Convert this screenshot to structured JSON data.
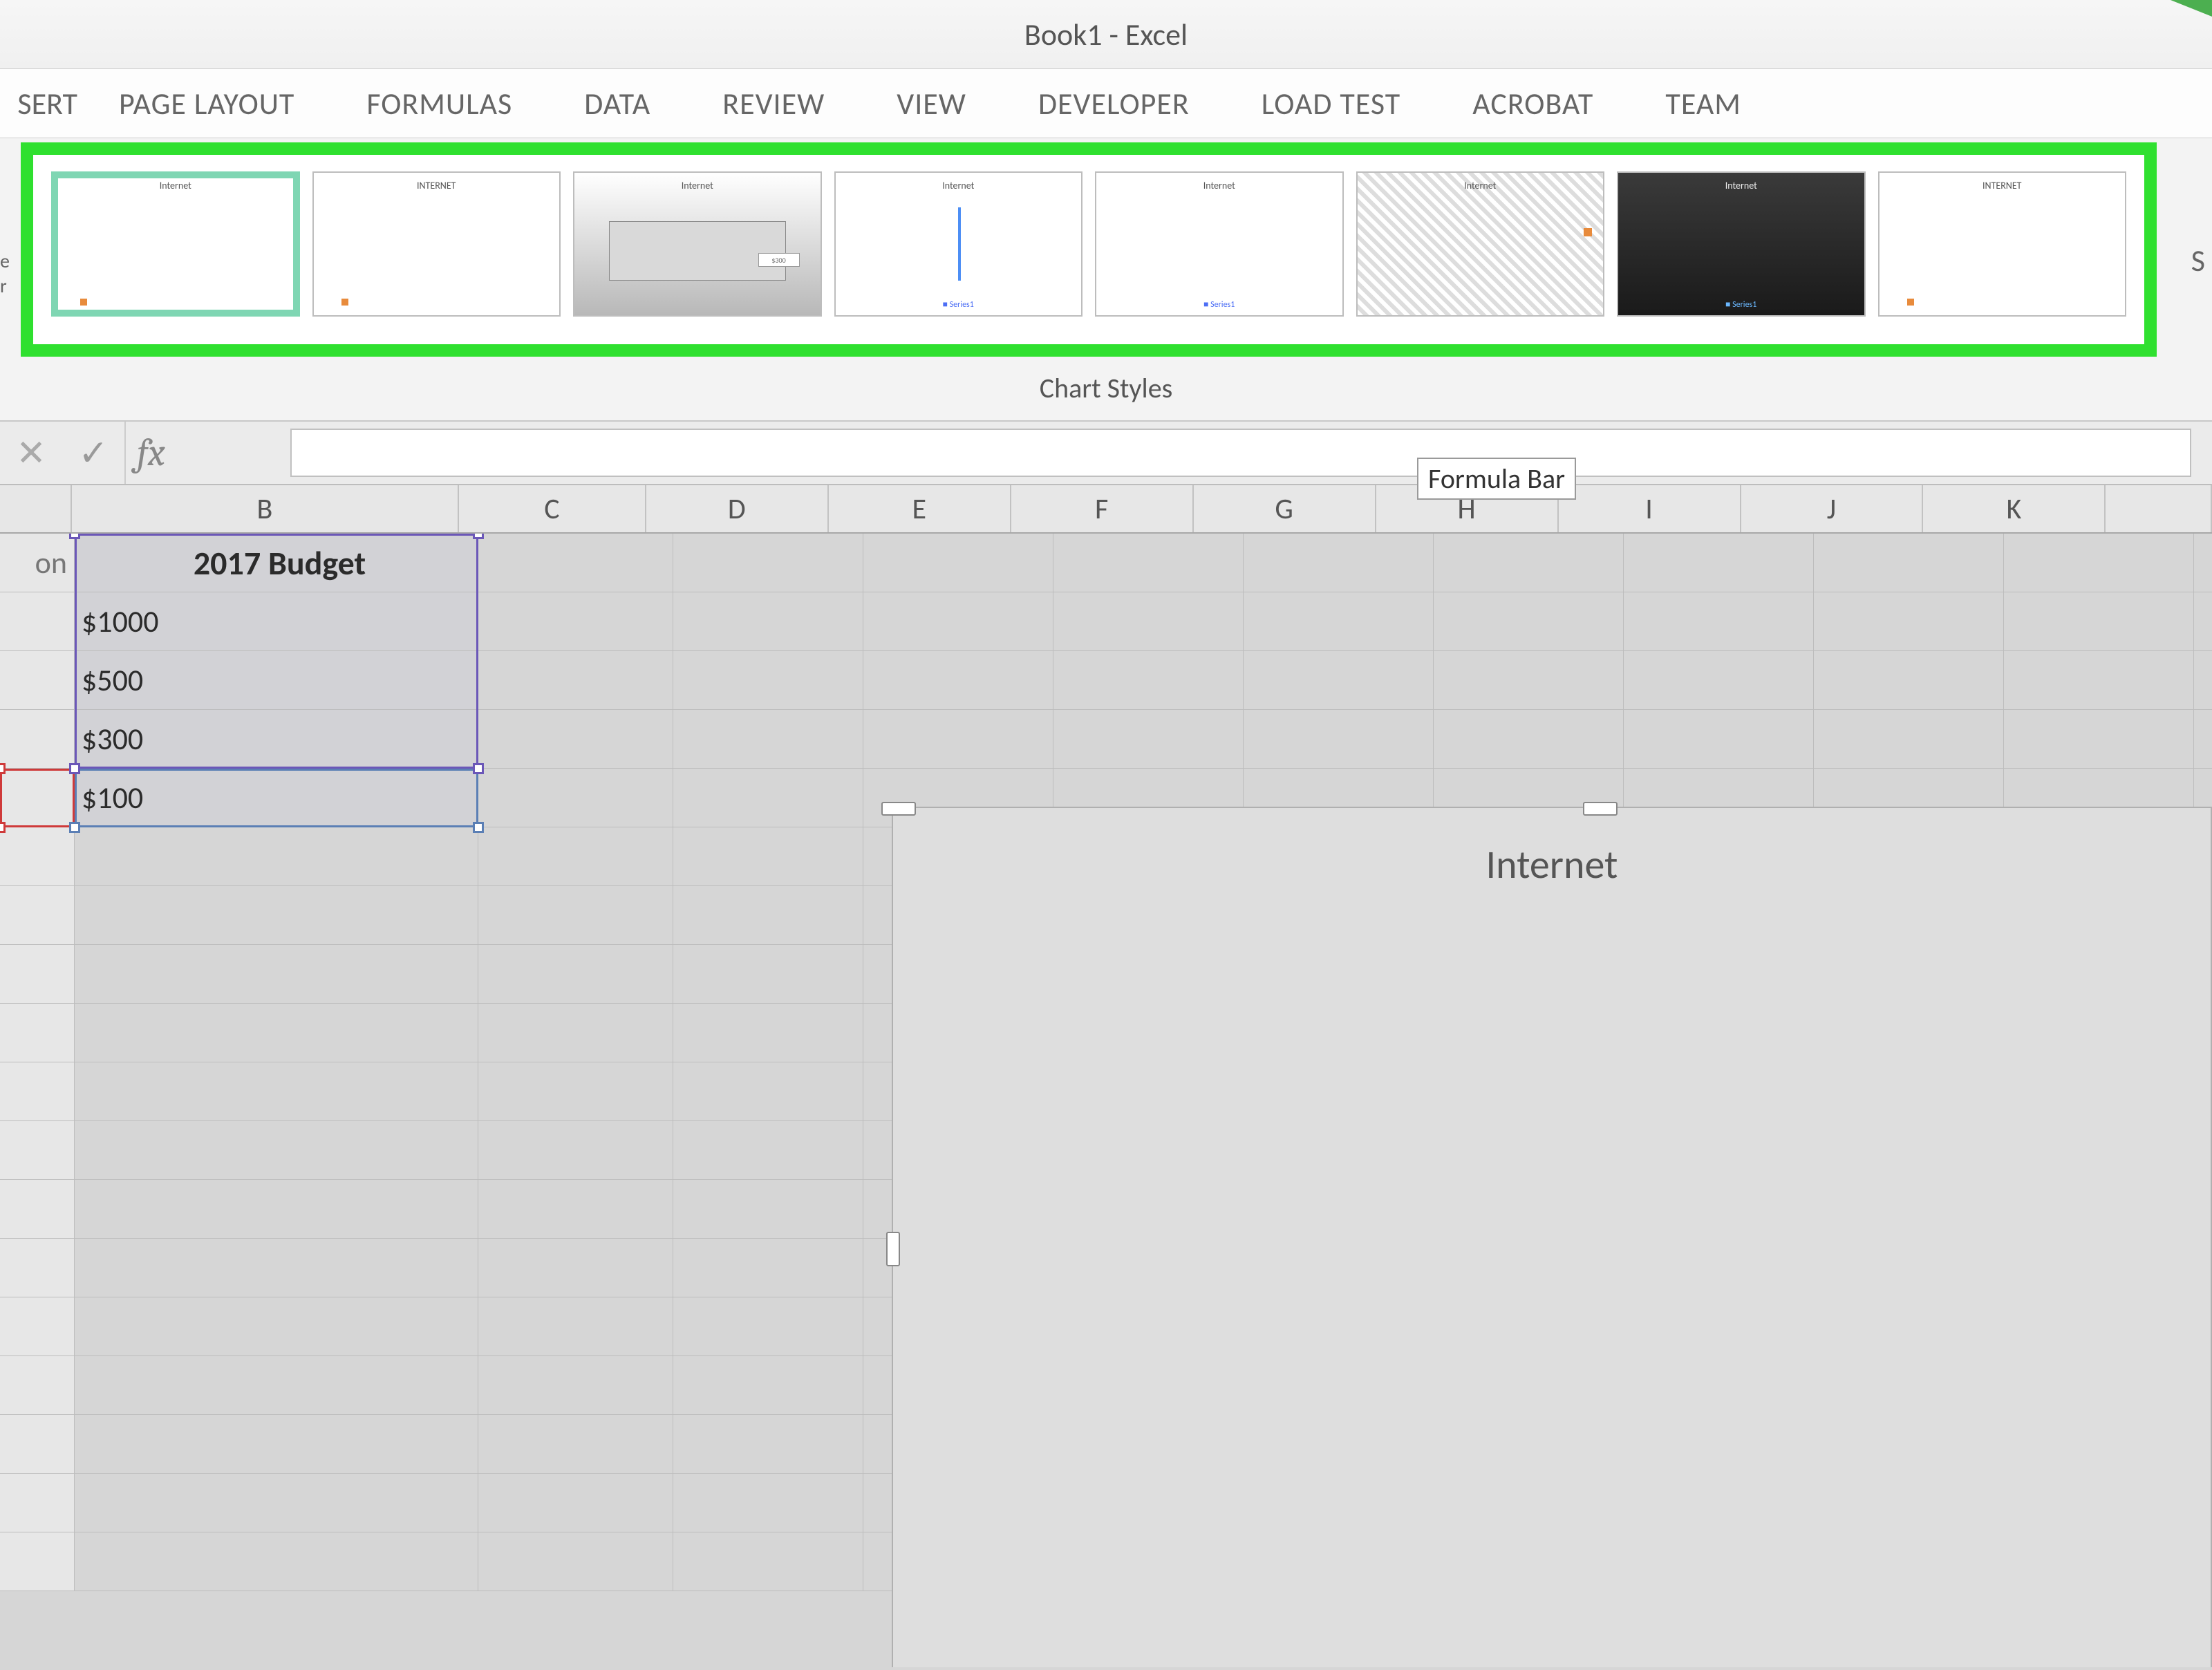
{
  "window": {
    "title": "Book1 - Excel"
  },
  "ribbon": {
    "tab_partial_left": "SERT",
    "tabs": [
      "PAGE LAYOUT",
      "FORMULAS",
      "DATA",
      "REVIEW",
      "VIEW",
      "DEVELOPER",
      "LOAD TEST",
      "ACROBAT",
      "TEAM"
    ],
    "side_partial_left_line1": "e",
    "side_partial_left_line2": "r",
    "side_letter_right": "S",
    "group_label": "Chart Styles",
    "style_labels": [
      "Internet",
      "INTERNET",
      "Internet",
      "Internet",
      "Internet",
      "Internet",
      "Internet",
      "INTERNET"
    ],
    "selected_style_index": 0
  },
  "formula_bar": {
    "fx_symbol": "fx",
    "value": "",
    "tooltip": "Formula Bar"
  },
  "columns": [
    "B",
    "C",
    "D",
    "E",
    "F",
    "G",
    "H",
    "I",
    "J",
    "K"
  ],
  "row_header_partial": "on",
  "cells": {
    "B": [
      "2017 Budget",
      "$1000",
      "$500",
      "$300",
      "$100"
    ]
  },
  "chart": {
    "title": "Internet"
  },
  "chart_data": {
    "type": "bar",
    "title": "Internet",
    "categories": [],
    "values": [],
    "note": "Embedded chart object visible with title only; plot area not shown in crop",
    "source_range_header": "2017 Budget",
    "source_range_values": [
      1000,
      500,
      300,
      100
    ]
  }
}
